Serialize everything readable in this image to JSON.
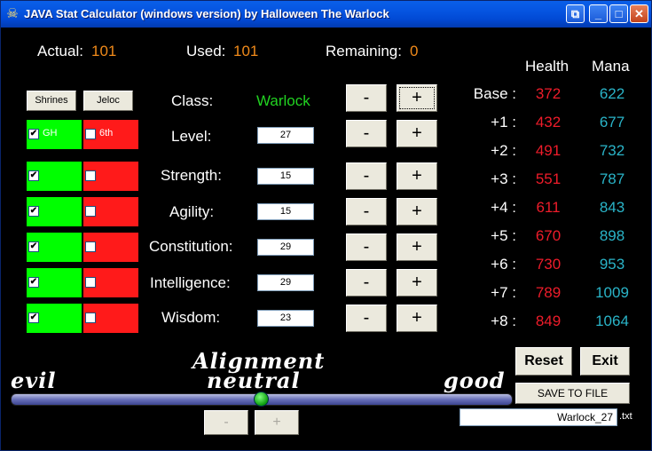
{
  "window": {
    "title": "JAVA Stat Calculator (windows version) by Halloween The Warlock",
    "buttons": {
      "restore": "⧉",
      "minimize": "_",
      "maximize": "□",
      "close": "✕"
    }
  },
  "summary": {
    "actual_label": "Actual:",
    "actual_value": "101",
    "used_label": "Used:",
    "used_value": "101",
    "remaining_label": "Remaining:",
    "remaining_value": "0"
  },
  "headers": {
    "health": "Health",
    "mana": "Mana"
  },
  "options": {
    "shrines_label": "Shrines",
    "jeloc_label": "Jeloc",
    "gh_label": "GH",
    "sixth_label": "6th",
    "check_mark": "✔"
  },
  "stats": [
    {
      "label": "Class:",
      "value": "Warlock"
    },
    {
      "label": "Level:",
      "value": "27"
    },
    {
      "label": "Strength:",
      "value": "15"
    },
    {
      "label": "Agility:",
      "value": "15"
    },
    {
      "label": "Constitution:",
      "value": "29"
    },
    {
      "label": "Intelligence:",
      "value": "29"
    },
    {
      "label": "Wisdom:",
      "value": "23"
    }
  ],
  "pm": {
    "minus": "-",
    "plus": "+"
  },
  "table": [
    {
      "label": "Base :",
      "health": "372",
      "mana": "622"
    },
    {
      "label": "+1 :",
      "health": "432",
      "mana": "677"
    },
    {
      "label": "+2 :",
      "health": "491",
      "mana": "732"
    },
    {
      "label": "+3 :",
      "health": "551",
      "mana": "787"
    },
    {
      "label": "+4 :",
      "health": "611",
      "mana": "843"
    },
    {
      "label": "+5 :",
      "health": "670",
      "mana": "898"
    },
    {
      "label": "+6 :",
      "health": "730",
      "mana": "953"
    },
    {
      "label": "+7 :",
      "health": "789",
      "mana": "1009"
    },
    {
      "label": "+8 :",
      "health": "849",
      "mana": "1064"
    }
  ],
  "actions": {
    "reset": "Reset",
    "exit": "Exit",
    "save": "SAVE TO FILE"
  },
  "file": {
    "name": "Warlock_27",
    "ext": ".txt"
  },
  "alignment": {
    "title": "Alignment",
    "current": "neutral",
    "left": "evil",
    "right": "good",
    "level": 0.5,
    "minus": "-",
    "plus": "+"
  },
  "colors": {
    "actual": "#f08a1a",
    "class": "#21d221",
    "health": "#ee1c2a",
    "mana": "#2ab4c8",
    "checked_box": "#00ff00",
    "unchecked_box": "#ff1a1a"
  }
}
